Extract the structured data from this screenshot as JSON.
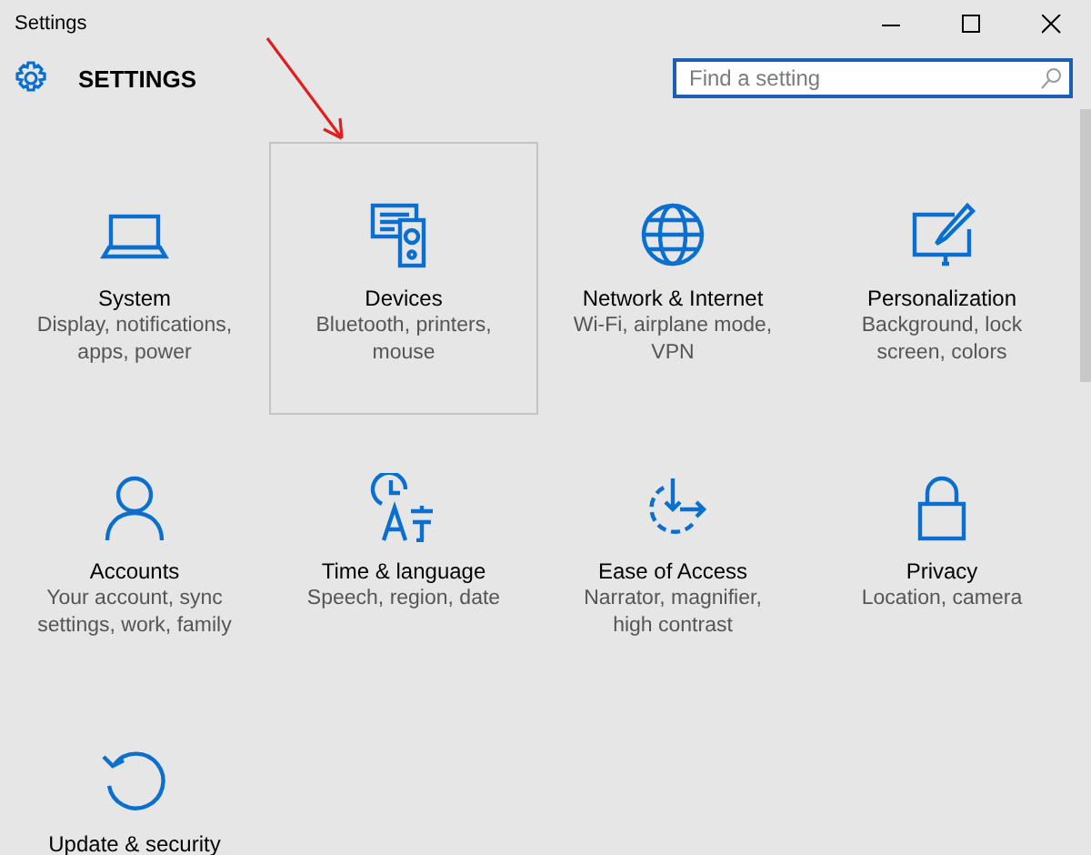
{
  "window": {
    "title": "Settings"
  },
  "header": {
    "title": "SETTINGS"
  },
  "search": {
    "placeholder": "Find a setting"
  },
  "categories": [
    {
      "kind": "laptop",
      "title": "System",
      "subtitle": "Display, notifications, apps, power",
      "selected": false
    },
    {
      "kind": "devices",
      "title": "Devices",
      "subtitle": "Bluetooth, printers, mouse",
      "selected": true
    },
    {
      "kind": "globe",
      "title": "Network & Internet",
      "subtitle": "Wi-Fi, airplane mode, VPN",
      "selected": false
    },
    {
      "kind": "brush",
      "title": "Personalization",
      "subtitle": "Background, lock screen, colors",
      "selected": false
    },
    {
      "kind": "person",
      "title": "Accounts",
      "subtitle": "Your account, sync settings, work, family",
      "selected": false
    },
    {
      "kind": "clock",
      "title": "Time & language",
      "subtitle": "Speech, region, date",
      "selected": false
    },
    {
      "kind": "ease",
      "title": "Ease of Access",
      "subtitle": "Narrator, magnifier, high contrast",
      "selected": false
    },
    {
      "kind": "lock",
      "title": "Privacy",
      "subtitle": "Location, camera",
      "selected": false
    },
    {
      "kind": "update",
      "title": "Update & security",
      "selected": false
    }
  ]
}
